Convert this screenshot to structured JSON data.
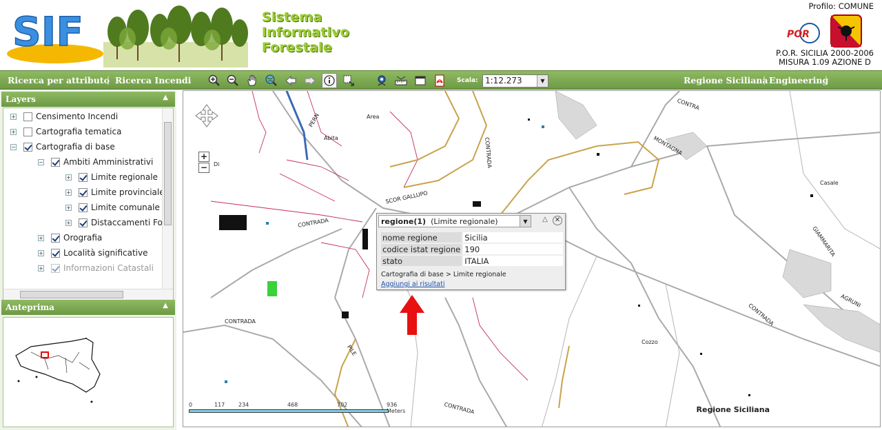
{
  "header": {
    "logo_text": "SIF",
    "title_lines": [
      "Sistema",
      "Informativo",
      "Forestale"
    ],
    "profile": "Profilo: COMUNE",
    "por_logo": "POR",
    "por_lines": [
      "P.O.R. SICILIA 2000-2006",
      "MISURA 1.09 AZIONE D"
    ]
  },
  "toolbar": {
    "link_search_attr": "Ricerca per attributo",
    "link_search_fires": "Ricerca Incendi",
    "tools": [
      "zoom-in-icon",
      "zoom-out-icon",
      "pan-hand-icon",
      "zoom-globe-icon",
      "back-arrow-icon",
      "forward-arrow-icon",
      "info-icon",
      "select-area-icon",
      "locate-pin-icon",
      "measure-ruler-icon",
      "window-icon",
      "pdf-icon"
    ],
    "scale_label": "Scala:",
    "scale_value": "1:12.273",
    "link_region": "Regione Siciliana",
    "link_engineering": "Engineering",
    "accent_color": "#7aa64f"
  },
  "layers": {
    "title": "Layers",
    "items": [
      {
        "label": "Censimento Incendi",
        "checked": false
      },
      {
        "label": "Cartografia tematica",
        "checked": false
      },
      {
        "label": "Cartografia di base",
        "checked": true
      },
      {
        "label": "Ambiti Amministrativi",
        "checked": true
      },
      {
        "label": "Limite regionale",
        "checked": true
      },
      {
        "label": "Limite provinciale",
        "checked": true
      },
      {
        "label": "Limite comunale",
        "checked": true
      },
      {
        "label": "Distaccamenti For",
        "checked": true
      },
      {
        "label": "Orografia",
        "checked": true
      },
      {
        "label": "Località significative",
        "checked": true
      },
      {
        "label": "Informazioni Catastali",
        "checked": true
      }
    ]
  },
  "preview": {
    "title": "Anteprima"
  },
  "map": {
    "labels": [
      "PERN",
      "Area",
      "Abita",
      "CONTRADA",
      "SCOR GALLUPO",
      "CONTRADA",
      "CONTRADA",
      "CONTRA",
      "MONTAGNA",
      "Casale",
      "GIAMMARITA",
      "CONTRADA",
      "AGRUNI",
      "Cozzo",
      "PILE",
      "CONTRADA",
      "Di"
    ],
    "attribution": "Regione Siciliana",
    "scalebar": [
      "0",
      "117",
      "234",
      "468",
      "702",
      "936 Meters"
    ]
  },
  "popup": {
    "select_label": "regione(1)",
    "select_layer": "(Limite regionale)",
    "rows": [
      {
        "key": "nome regione",
        "value": "Sicilia"
      },
      {
        "key": "codice istat regione",
        "value": "190"
      },
      {
        "key": "stato",
        "value": "ITALIA"
      }
    ],
    "path": "Cartografia di base > Limite regionale",
    "add_link": "Aggiungi ai risultati"
  }
}
